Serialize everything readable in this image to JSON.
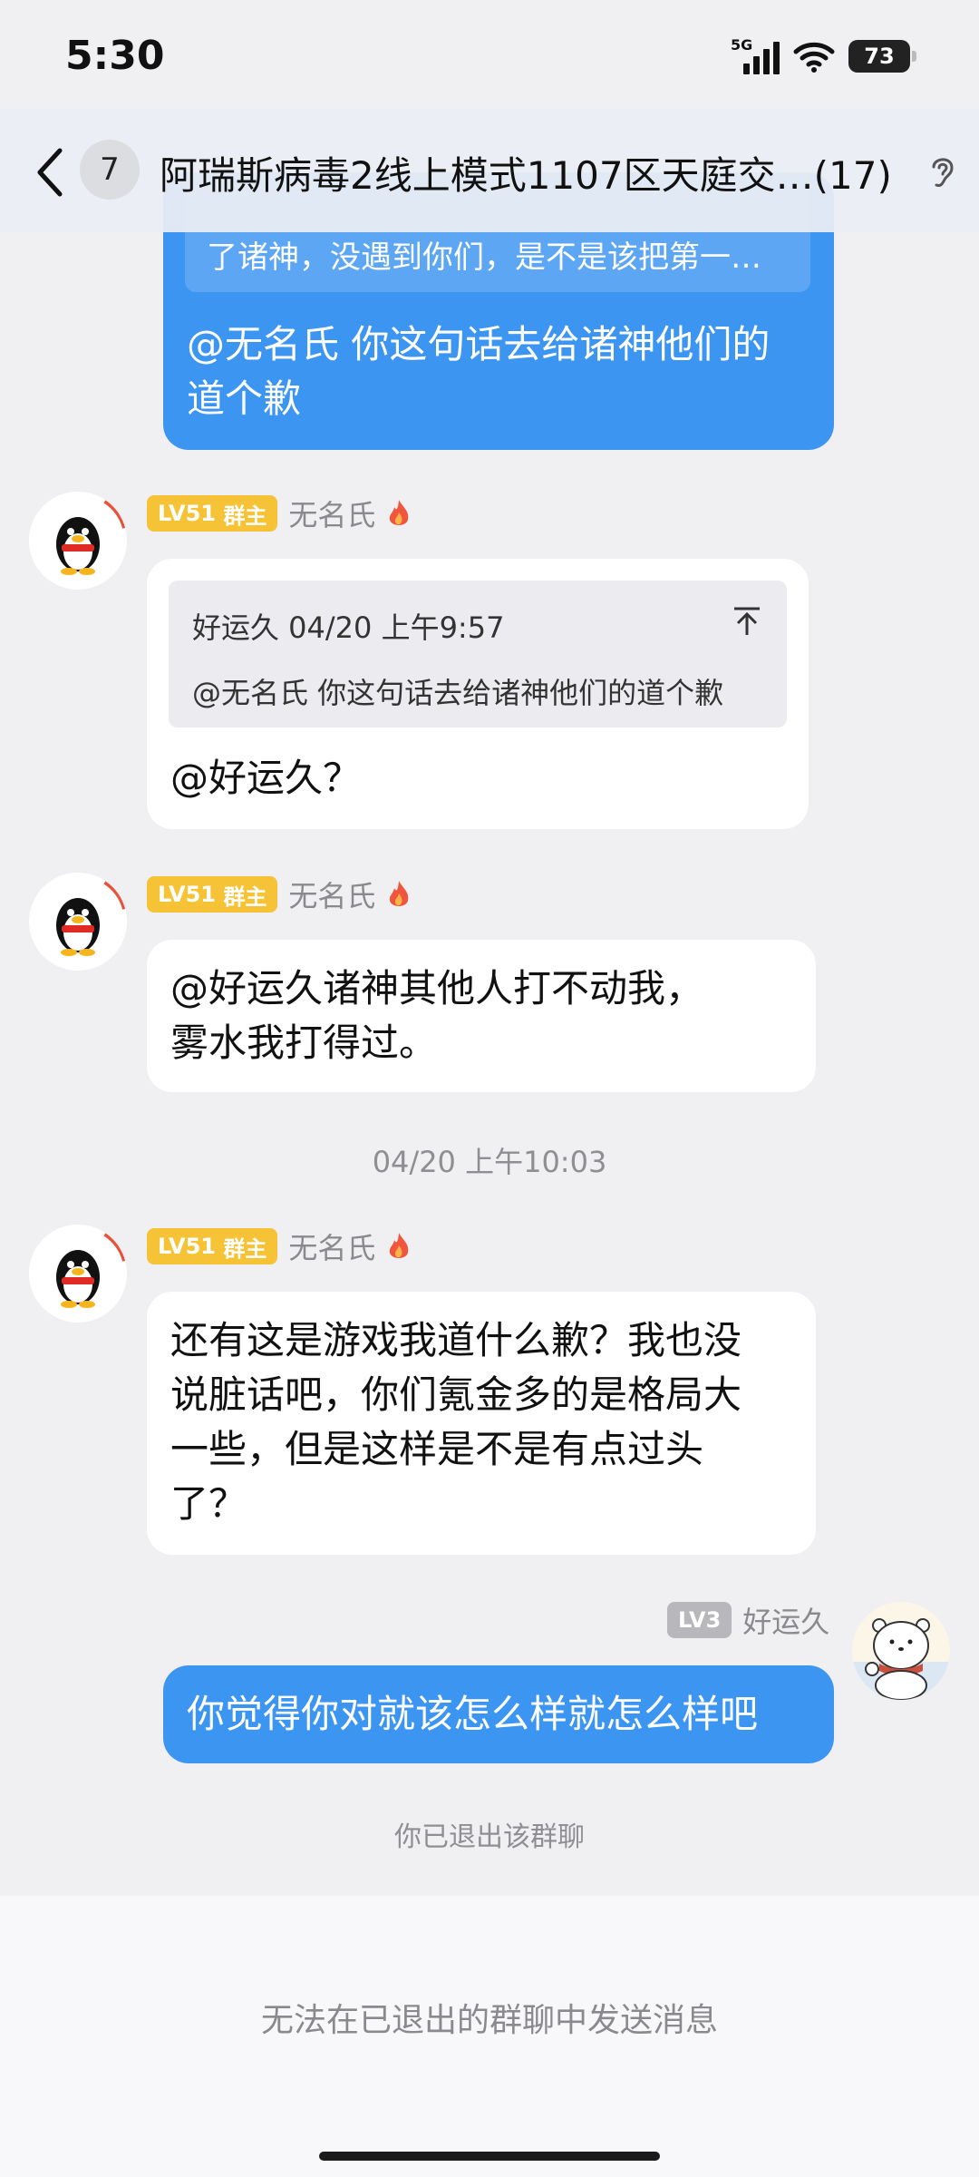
{
  "status_bar": {
    "time": "5:30",
    "network": "5G",
    "battery": "73"
  },
  "header": {
    "unread_count": "7",
    "title": "阿瑞斯病毒2线上模式1107区天庭交…(17)"
  },
  "messages": {
    "m1": {
      "quote_preview": "了诸神，没遇到你们，是不是该把第一…",
      "line1": "@无名氏 你这句话去给诸神他们的",
      "line2": "道个歉"
    },
    "m2": {
      "level": "LV51",
      "role": "群主",
      "sender": "无名氏",
      "quote_header": "好运久 04/20 上午9:57",
      "quote_body": "@无名氏 你这句话去给诸神他们的道个歉",
      "text": "@好运久？"
    },
    "m3": {
      "level": "LV51",
      "role": "群主",
      "sender": "无名氏",
      "line1": "@好运久诸神其他人打不动我，",
      "line2": "雾水我打得过。"
    },
    "timestamp": "04/20 上午10:03",
    "m4": {
      "level": "LV51",
      "role": "群主",
      "sender": "无名氏",
      "line1": "还有这是游戏我道什么歉？我也没",
      "line2": "说脏话吧，你们氪金多的是格局大",
      "line3": "一些，但是这样是不是有点过头",
      "line4": "了？"
    },
    "m5": {
      "level": "LV3",
      "sender": "好运久",
      "text": "你觉得你对就该怎么样就怎么样吧"
    },
    "system_notice": "你已退出该群聊"
  },
  "footer": {
    "notice": "无法在已退出的群聊中发送消息"
  },
  "colors": {
    "bubble_blue": "#3d95f2",
    "badge_gold": "#f6c336",
    "badge_grey": "#b7b7bc"
  },
  "icons": [
    "back-arrow-icon",
    "ear-icon",
    "fire-icon",
    "jump-to-quote-icon",
    "penguin-avatar",
    "polar-bear-avatar"
  ]
}
